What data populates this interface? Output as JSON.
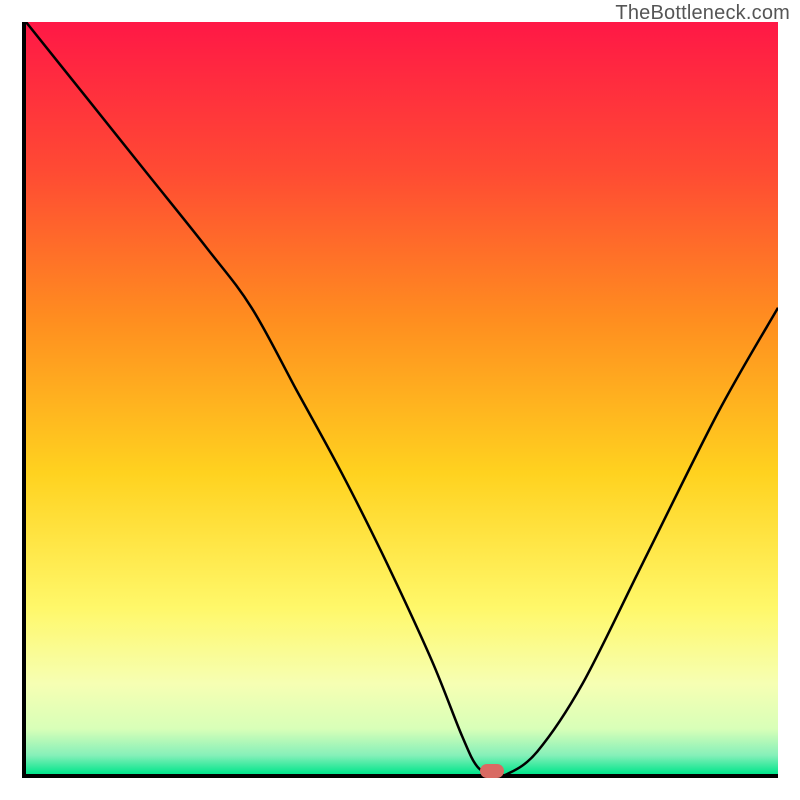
{
  "watermark": "TheBottleneck.com",
  "chart_data": {
    "type": "line",
    "title": "",
    "xlabel": "",
    "ylabel": "",
    "xlim": [
      0,
      100
    ],
    "ylim": [
      0,
      100
    ],
    "x": [
      0,
      8,
      16,
      24,
      30,
      36,
      42,
      48,
      54,
      58,
      60,
      62,
      64,
      68,
      74,
      82,
      92,
      100
    ],
    "values": [
      100,
      90,
      80,
      70,
      62,
      51,
      40,
      28,
      15,
      5,
      1,
      0,
      0,
      3,
      12,
      28,
      48,
      62
    ],
    "gradient_stops": [
      {
        "pos": 0.0,
        "color": "#ff1846"
      },
      {
        "pos": 0.2,
        "color": "#ff4b33"
      },
      {
        "pos": 0.4,
        "color": "#ff8f1f"
      },
      {
        "pos": 0.6,
        "color": "#ffd21f"
      },
      {
        "pos": 0.78,
        "color": "#fff86a"
      },
      {
        "pos": 0.88,
        "color": "#f6ffb3"
      },
      {
        "pos": 0.94,
        "color": "#d8ffb8"
      },
      {
        "pos": 0.975,
        "color": "#86f0b9"
      },
      {
        "pos": 1.0,
        "color": "#00e58b"
      }
    ],
    "marker": {
      "x": 62,
      "y": 0,
      "color": "#d96a63"
    }
  }
}
